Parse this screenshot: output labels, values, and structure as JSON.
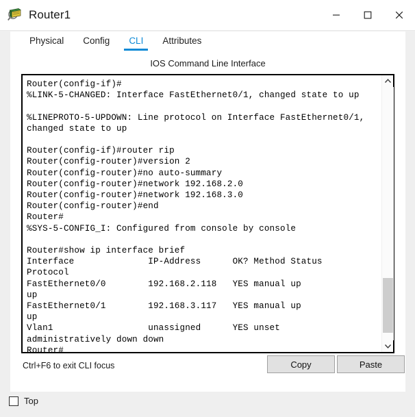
{
  "window": {
    "title": "Router1",
    "icon": "router-device-icon",
    "controls": {
      "minimize": "minimize-icon",
      "maximize": "maximize-icon",
      "close": "close-icon"
    }
  },
  "tabs": [
    {
      "label": "Physical",
      "active": false
    },
    {
      "label": "Config",
      "active": false
    },
    {
      "label": "CLI",
      "active": true
    },
    {
      "label": "Attributes",
      "active": false
    }
  ],
  "cli": {
    "header": "IOS Command Line Interface",
    "terminal_text": "Router(config-if)#\n%LINK-5-CHANGED: Interface FastEthernet0/1, changed state to up\n\n%LINEPROTO-5-UPDOWN: Line protocol on Interface FastEthernet0/1,\nchanged state to up\n\nRouter(config-if)#router rip\nRouter(config-router)#version 2\nRouter(config-router)#no auto-summary\nRouter(config-router)#network 192.168.2.0\nRouter(config-router)#network 192.168.3.0\nRouter(config-router)#end\nRouter#\n%SYS-5-CONFIG_I: Configured from console by console\n\nRouter#show ip interface brief\nInterface              IP-Address      OK? Method Status\nProtocol\nFastEthernet0/0        192.168.2.118   YES manual up\nup\nFastEthernet0/1        192.168.3.117   YES manual up\nup\nVlan1                  unassigned      YES unset\nadministratively down down\nRouter#",
    "hint": "Ctrl+F6 to exit CLI focus",
    "copy_label": "Copy",
    "paste_label": "Paste",
    "scroll_up_icon": "chevron-up-icon",
    "scroll_down_icon": "chevron-down-icon"
  },
  "footer": {
    "top_label": "Top",
    "top_checked": false
  },
  "colors": {
    "accent": "#0d8ad6",
    "window_bg": "#efefef",
    "panel_bg": "#ffffff",
    "button_bg": "#e1e1e1",
    "terminal_border": "#000000",
    "scrollbar_thumb": "#cdcdcd"
  }
}
